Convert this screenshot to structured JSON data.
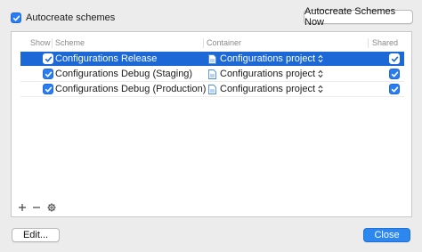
{
  "top": {
    "autocreate_label": "Autocreate schemes",
    "autocreate_checked": true,
    "autocreate_now_label": "Autocreate Schemes Now"
  },
  "table": {
    "headers": {
      "show": "Show",
      "scheme": "Scheme",
      "container": "Container",
      "shared": "Shared"
    },
    "rows": [
      {
        "show": true,
        "name": "Configurations Release",
        "container": "Configurations project",
        "shared": true,
        "selected": true
      },
      {
        "show": true,
        "name": "Configurations Debug (Staging)",
        "container": "Configurations project",
        "shared": true,
        "selected": false
      },
      {
        "show": true,
        "name": "Configurations Debug (Production)",
        "container": "Configurations project",
        "shared": true,
        "selected": false
      }
    ]
  },
  "tools": {
    "add_icon": "plus-icon",
    "remove_icon": "minus-icon",
    "gear_icon": "gear-icon"
  },
  "footer": {
    "edit_label": "Edit...",
    "close_label": "Close"
  },
  "colors": {
    "accent": "#1b68d6",
    "close_button": "#2c87ef",
    "window_bg": "#ececec"
  }
}
